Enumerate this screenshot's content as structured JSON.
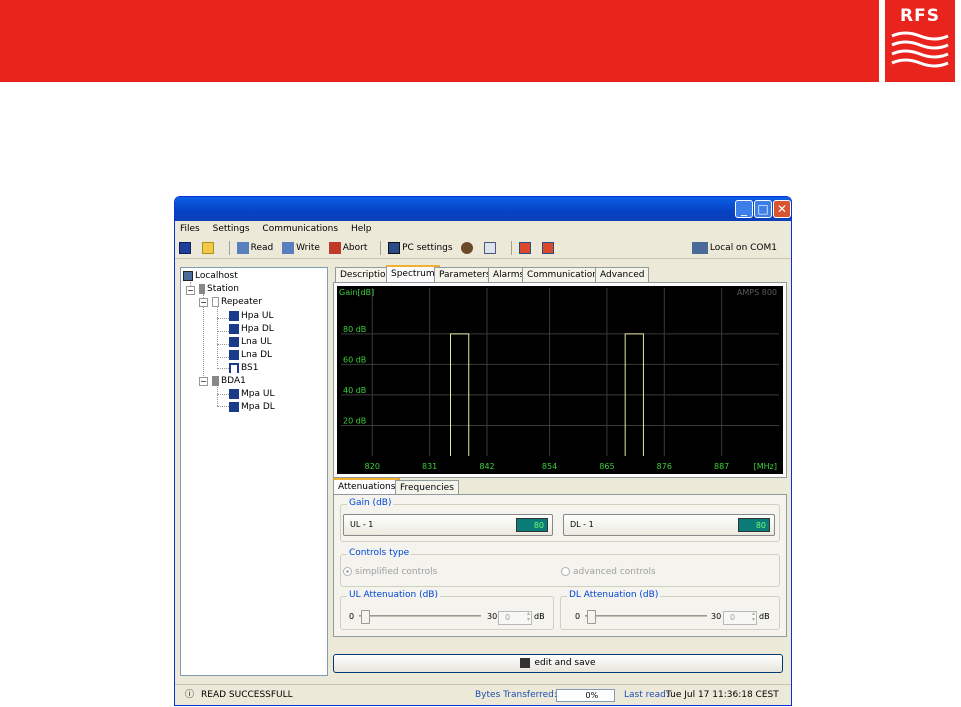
{
  "brand": {
    "logo_text": "RFS",
    "red": "#e8241c"
  },
  "window": {
    "controls": [
      "minimize",
      "maximize",
      "close"
    ]
  },
  "menu": {
    "items": [
      "Files",
      "Settings",
      "Communications",
      "Help"
    ]
  },
  "toolbar": {
    "read_label": "Read",
    "write_label": "Write",
    "abort_label": "Abort",
    "pc_settings_label": "PC settings",
    "connection_label": "Local on COM1"
  },
  "tree": {
    "localhost": "Localhost",
    "station": "Station",
    "repeater": "Repeater",
    "hpa_ul": "Hpa UL",
    "hpa_dl": "Hpa DL",
    "lna_ul": "Lna UL",
    "lna_dl": "Lna DL",
    "bs1": "BS1",
    "bda1": "BDA1",
    "mpa_ul": "Mpa UL",
    "mpa_dl": "Mpa DL"
  },
  "tabs": [
    "Description",
    "Spectrum",
    "Parameters",
    "Alarms",
    "Communications",
    "Advanced"
  ],
  "active_tab": "Spectrum",
  "chart_data": {
    "type": "line",
    "ylabel": "Gain[dB]",
    "xlabel": "[MHz]",
    "band_label": "AMPS 800",
    "x_ticks": [
      "820",
      "831",
      "842",
      "854",
      "865",
      "876",
      "887"
    ],
    "y_ticks": [
      "20 dB",
      "40 dB",
      "60 dB",
      "80 dB"
    ],
    "xlim": [
      814,
      898
    ],
    "ylim": [
      0,
      110
    ],
    "series": [
      {
        "segments": [
          [
            835,
            838.5
          ],
          [
            868.5,
            872
          ]
        ],
        "value": 80
      }
    ],
    "colors": {
      "background": "#000000",
      "grid": "#3a3a3a",
      "text": "#3ccf3c",
      "trace": "#e8e8a0"
    }
  },
  "subtabs": [
    "Attenuations",
    "Frequencies"
  ],
  "active_subtab": "Attenuations",
  "gain": {
    "title": "Gain (dB)",
    "ul_label": "UL - 1",
    "ul_value": "80",
    "dl_label": "DL - 1",
    "dl_value": "80"
  },
  "controls_type": {
    "title": "Controls type",
    "simplified": "simplified controls",
    "advanced": "advanced controls"
  },
  "ul_att": {
    "title": "UL Attenuation (dB)",
    "min": "0",
    "max": "30",
    "value": "0",
    "unit": "dB"
  },
  "dl_att": {
    "title": "DL Attenuation (dB)",
    "min": "0",
    "max": "30",
    "value": "0",
    "unit": "dB"
  },
  "save_label": "edit and save",
  "status": {
    "message": "READ SUCCESSFULL",
    "bytes_label": "Bytes Transferred:",
    "bytes_value": "0%",
    "last_read_label": "Last read:",
    "last_read_value": "Tue Jul 17 11:36:18 CEST 2007"
  }
}
